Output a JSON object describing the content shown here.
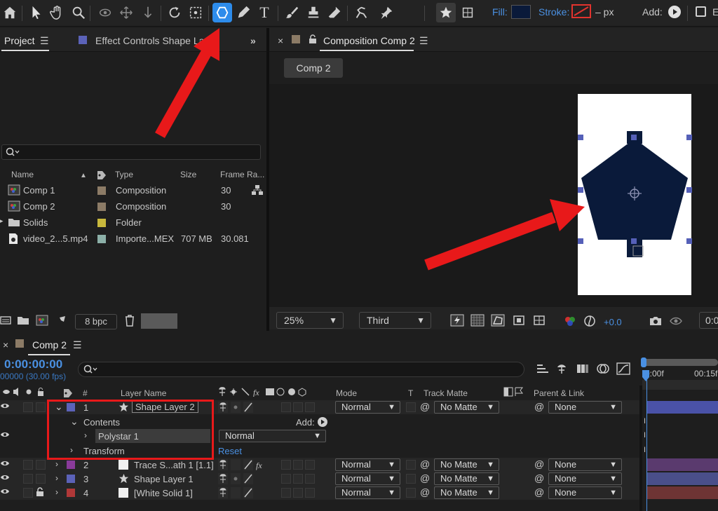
{
  "toolbar": {
    "fill_label": "Fill:",
    "stroke_label": "Stroke:",
    "stroke_unit": "– px",
    "add_label": "Add:",
    "fill_color": "#0a1a3a",
    "accent": "#2d8ceb",
    "icons": [
      "home-icon",
      "selection-tool-icon",
      "hand-tool-icon",
      "zoom-tool-icon",
      "orbit-camera-icon",
      "pan-camera-icon",
      "dolly-camera-icon",
      "rotate-tool-icon",
      "pan-behind-icon",
      "shape-tool-icon",
      "pen-tool-icon",
      "type-tool-icon",
      "brush-tool-icon",
      "clone-stamp-icon",
      "eraser-tool-icon",
      "roto-brush-icon",
      "puppet-pin-icon",
      "star-tool-icon"
    ]
  },
  "project": {
    "tab_project": "Project",
    "tab_effect": "Effect Controls Shape Lay",
    "columns": {
      "name": "Name",
      "type": "Type",
      "size": "Size",
      "frame_rate": "Frame Ra..."
    },
    "items": [
      {
        "name": "Comp 1",
        "type": "Composition",
        "size": "",
        "frame_rate": "30",
        "label_color": "#8c7b66",
        "icon": "composition-icon"
      },
      {
        "name": "Comp 2",
        "type": "Composition",
        "size": "",
        "frame_rate": "30",
        "label_color": "#8c7b66",
        "icon": "composition-icon"
      },
      {
        "name": "Solids",
        "type": "Folder",
        "size": "",
        "frame_rate": "",
        "label_color": "#c8b83c",
        "icon": "folder-icon"
      },
      {
        "name": "video_2...5.mp4",
        "type": "Importe...MEX",
        "size": "707 MB",
        "frame_rate": "30.081",
        "label_color": "#8cb0a8",
        "icon": "video-file-icon"
      }
    ],
    "bpc": "8 bpc"
  },
  "composition": {
    "tab_title": "Composition Comp 2",
    "comp_button": "Comp 2",
    "zoom": "25%",
    "resolution": "Third",
    "exposure": "+0.0",
    "time_short": "0:0",
    "shape_color": "#0a1a3a"
  },
  "timeline": {
    "tab_title": "Comp 2",
    "current_time": "0:00:00:00",
    "fps_line": "00000 (30.00 fps)",
    "ruler_start": "0:00f",
    "ruler_mark": "00:15f",
    "headers": {
      "num": "#",
      "layer_name": "Layer Name",
      "mode": "Mode",
      "t": "T",
      "track_matte": "Track Matte",
      "parent": "Parent & Link"
    },
    "layers": [
      {
        "num": "1",
        "name": "Shape Layer 2",
        "mode": "Normal",
        "matte": "No Matte",
        "parent": "None",
        "label_color": "#5b62b8",
        "bar_color": "#4a52a8",
        "icon": "star-icon"
      },
      {
        "num": "2",
        "name": "Trace S...ath 1 [1.1]",
        "mode": "Normal",
        "matte": "No Matte",
        "parent": "None",
        "label_color": "#8a3b9a",
        "bar_color": "#5a3a6e",
        "icon": "solid-icon"
      },
      {
        "num": "3",
        "name": "Shape Layer 1",
        "mode": "Normal",
        "matte": "No Matte",
        "parent": "None",
        "label_color": "#5b62b8",
        "bar_color": "#4a4f8a",
        "icon": "star-icon"
      },
      {
        "num": "4",
        "name": "[White Solid 1]",
        "mode": "Normal",
        "matte": "No Matte",
        "parent": "None",
        "label_color": "#b03838",
        "bar_color": "#6e3434",
        "icon": "solid-icon"
      }
    ],
    "contents_label": "Contents",
    "add_label": "Add:",
    "polystar_label": "Polystar 1",
    "polystar_mode": "Normal",
    "transform_label": "Transform",
    "reset_label": "Reset"
  }
}
